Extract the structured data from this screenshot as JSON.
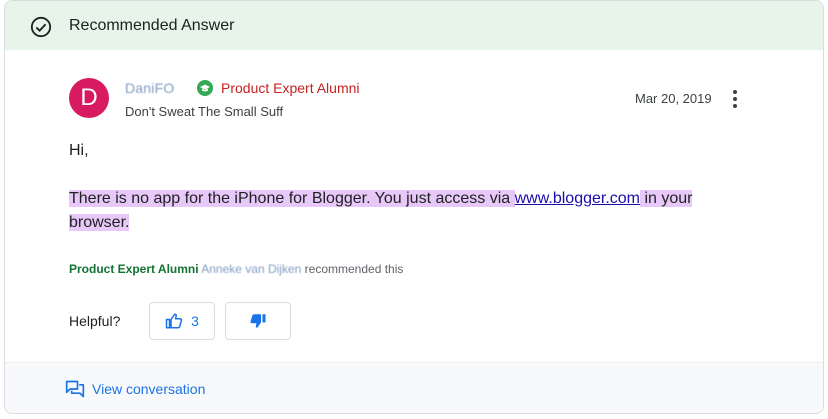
{
  "header": {
    "title": "Recommended Answer",
    "icon": "check-circle-icon"
  },
  "author": {
    "avatar_letter": "D",
    "avatar_color": "#d81b60",
    "name": "DaniFO",
    "badge_icon": "graduation-cap-icon",
    "badge_label": "Product Expert Alumni",
    "subtitle": "Don't Sweat The Small Suff",
    "date": "Mar 20, 2019"
  },
  "post": {
    "greeting": "Hi,",
    "text_before_link": "There is no app for the iPhone for Blogger. You just access via ",
    "link_text": "www.blogger.com",
    "text_after_link": " in your browser."
  },
  "recommendation": {
    "role": "Product Expert Alumni",
    "name": "Anneke van Dijken",
    "suffix": "recommended this"
  },
  "feedback": {
    "label": "Helpful?",
    "upvote_count": "3",
    "upvote_icon": "thumbs-up-icon",
    "downvote_icon": "thumbs-down-icon"
  },
  "footer": {
    "link_label": "View conversation",
    "icon": "conversation-icon"
  },
  "colors": {
    "header_bg": "#e6f4ea",
    "highlight": "#e8c8f8",
    "link": "#1a73e8",
    "expert_red": "#c5221f",
    "expert_green": "#34a853"
  }
}
